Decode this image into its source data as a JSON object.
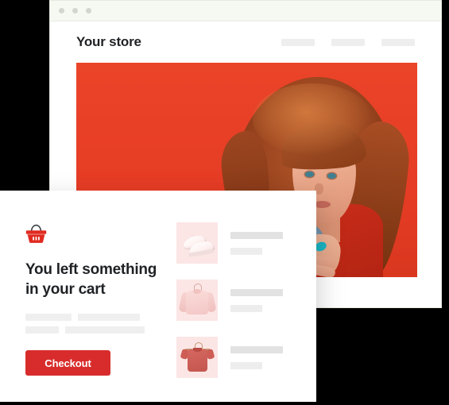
{
  "browser": {
    "window_name": "store-preview-window",
    "traffic_lights": [
      "close-dot",
      "minimize-dot",
      "maximize-dot"
    ],
    "titlebar_color": "#f6f8f2"
  },
  "store": {
    "title": "Your store",
    "nav_placeholders": [
      "nav-placeholder-1",
      "nav-placeholder-2",
      "nav-placeholder-3"
    ],
    "hero": {
      "name": "hero-banner-photo",
      "alt": "Woman with long red curly hair wearing a red top and denim jacket on a red background",
      "background_color": "#e8402a"
    }
  },
  "cart_card": {
    "icon": "shopping-basket-icon",
    "icon_color": "#e02b20",
    "heading": "You left something in your cart",
    "body_placeholders": [
      [
        "ph-1a",
        "ph-1b"
      ],
      [
        "ph-2a",
        "ph-2b"
      ]
    ],
    "checkout_label": "Checkout",
    "checkout_color": "#d82c2c",
    "products": [
      {
        "image": "white-sneakers-thumbnail",
        "title_placeholder": "product-title-placeholder",
        "sub_placeholder": "product-price-placeholder"
      },
      {
        "image": "pink-sweater-thumbnail",
        "title_placeholder": "product-title-placeholder",
        "sub_placeholder": "product-price-placeholder"
      },
      {
        "image": "coral-tshirt-thumbnail",
        "title_placeholder": "product-title-placeholder",
        "sub_placeholder": "product-price-placeholder"
      }
    ]
  }
}
